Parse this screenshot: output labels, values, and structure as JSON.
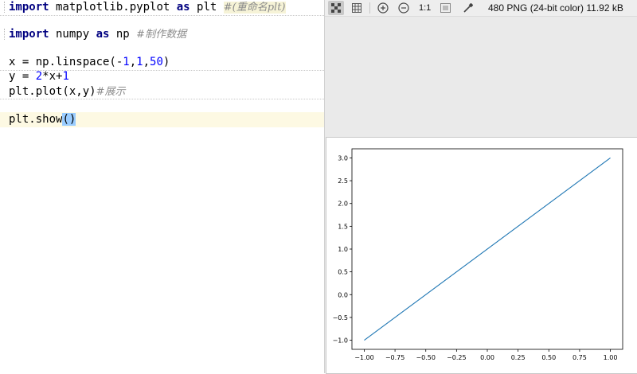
{
  "editor": {
    "lines": [
      {
        "id": "l1",
        "parts": [
          {
            "t": "import",
            "c": "kw"
          },
          {
            "t": " matplotlib.pyplot "
          },
          {
            "t": "as",
            "c": "kw"
          },
          {
            "t": " plt "
          },
          {
            "t": "#(重命名plt)",
            "c": "cmt cmt-box"
          }
        ]
      },
      {
        "id": "l2",
        "parts": [
          {
            "t": "import",
            "c": "kw"
          },
          {
            "t": " numpy "
          },
          {
            "t": "as",
            "c": "kw"
          },
          {
            "t": " np "
          },
          {
            "t": "#制作数据",
            "c": "cmt"
          }
        ]
      },
      {
        "id": "l3",
        "parts": [
          {
            "t": "x = np.linspace(-"
          },
          {
            "t": "1",
            "c": "num"
          },
          {
            "t": ","
          },
          {
            "t": "1",
            "c": "num"
          },
          {
            "t": ","
          },
          {
            "t": "50",
            "c": "num"
          },
          {
            "t": ")"
          }
        ]
      },
      {
        "id": "l4",
        "parts": [
          {
            "t": "y = "
          },
          {
            "t": "2",
            "c": "num"
          },
          {
            "t": "*x+"
          },
          {
            "t": "1",
            "c": "num"
          }
        ]
      },
      {
        "id": "l5",
        "parts": [
          {
            "t": "plt.plot(x,y)"
          },
          {
            "t": "#展示",
            "c": "cmt"
          }
        ]
      },
      {
        "id": "l6",
        "parts": [
          {
            "t": "plt.show"
          },
          {
            "t": "()",
            "c": "paren-match"
          }
        ]
      }
    ]
  },
  "viewer": {
    "zoom_label": "1:1",
    "info": "480 PNG (24-bit color) 11.92 kB",
    "icons": [
      "checkerboard-icon",
      "grid-icon",
      "zoom-in-icon",
      "zoom-out-icon",
      "actual-size",
      "fit-icon",
      "eyedropper-icon"
    ]
  },
  "chart_data": {
    "type": "line",
    "title": "",
    "xlabel": "",
    "ylabel": "",
    "xlim": [
      -1.1,
      1.1
    ],
    "ylim": [
      -1.2,
      3.2
    ],
    "xticks": [
      -1.0,
      -0.75,
      -0.5,
      -0.25,
      0.0,
      0.25,
      0.5,
      0.75,
      1.0
    ],
    "xtick_labels": [
      "−1.00",
      "−0.75",
      "−0.50",
      "−0.25",
      "0.00",
      "0.25",
      "0.50",
      "0.75",
      "1.00"
    ],
    "yticks": [
      -1.0,
      -0.5,
      0.0,
      0.5,
      1.0,
      1.5,
      2.0,
      2.5,
      3.0
    ],
    "ytick_labels": [
      "−1.0",
      "−0.5",
      "0.0",
      "0.5",
      "1.0",
      "1.5",
      "2.0",
      "2.5",
      "3.0"
    ],
    "series": [
      {
        "x": [
          -1.0,
          1.0
        ],
        "y": [
          -1.0,
          3.0
        ],
        "color": "#1f77b4"
      }
    ]
  }
}
